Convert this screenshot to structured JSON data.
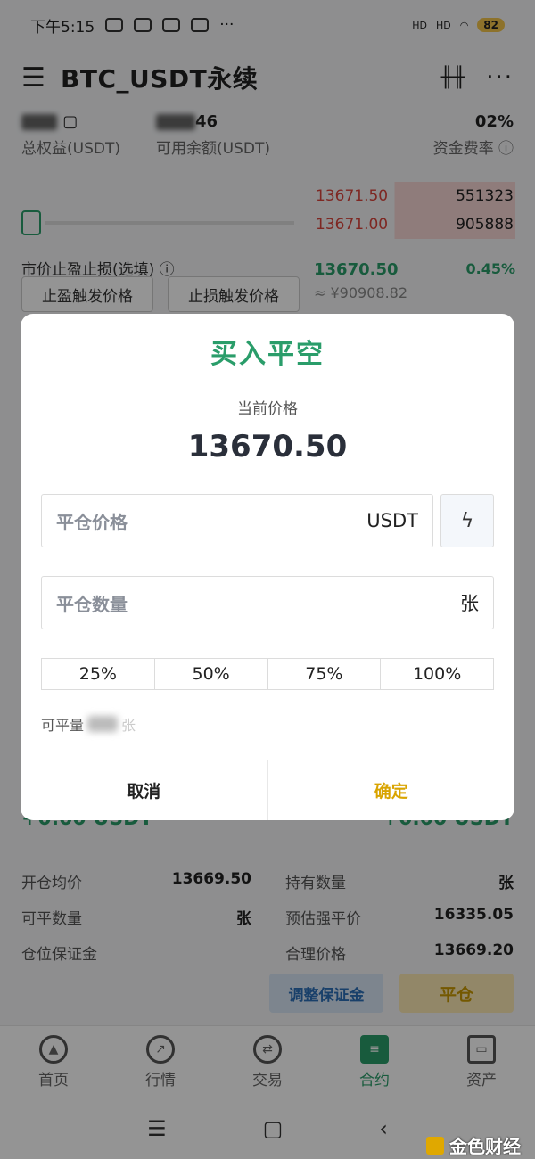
{
  "status": {
    "time": "下午5:15",
    "network1": "HD",
    "network2": "HD",
    "battery": "82"
  },
  "header": {
    "menu_icon": "☰",
    "title": "BTC_USDT永续",
    "more": "···"
  },
  "account": {
    "equity_label": "总权益(USDT)",
    "available_value": "46",
    "available_label": "可用余额(USDT)",
    "funding_value": "02%",
    "funding_label": "资金费率"
  },
  "orderbook": {
    "asks": [
      {
        "price": "13671.50",
        "qty": "551323"
      },
      {
        "price": "13671.00",
        "qty": "905888"
      }
    ],
    "last_price": "13670.50",
    "change": "0.45%",
    "cny": "≈ ¥90908.82"
  },
  "sltp": {
    "label": "市价止盈止损(选填)",
    "tp_button": "止盈触发价格",
    "sl_button": "止损触发价格"
  },
  "position": {
    "pnl_left": "+0.00 USDT",
    "pnl_right": "+0.00 USDT",
    "rows": [
      {
        "k1": "开仓均价",
        "v1": "13669.50",
        "k2": "持有数量",
        "v2": "张"
      },
      {
        "k1": "可平数量",
        "v1": "张",
        "k2": "预估强平价",
        "v2": "16335.05"
      },
      {
        "k1": "仓位保证金",
        "v1": "",
        "k2": "合理价格",
        "v2": "13669.20"
      }
    ],
    "adjust_margin": "调整保证金",
    "close": "平仓"
  },
  "tabbar": [
    {
      "label": "首页",
      "icon": "home-icon"
    },
    {
      "label": "行情",
      "icon": "chart-icon"
    },
    {
      "label": "交易",
      "icon": "swap-icon"
    },
    {
      "label": "合约",
      "icon": "contract-icon"
    },
    {
      "label": "资产",
      "icon": "wallet-icon"
    }
  ],
  "watermark": "金色财经",
  "modal": {
    "title": "买入平空",
    "current_price_label": "当前价格",
    "current_price": "13670.50",
    "close_price_placeholder": "平仓价格",
    "close_price_unit": "USDT",
    "close_qty_placeholder": "平仓数量",
    "close_qty_unit": "张",
    "percents": [
      "25%",
      "50%",
      "75%",
      "100%"
    ],
    "available_label": "可平量",
    "available_suffix": "张",
    "cancel": "取消",
    "confirm": "确定"
  },
  "colors": {
    "green": "#2a9d6a",
    "red": "#d9443b",
    "gold": "#d9a400"
  }
}
